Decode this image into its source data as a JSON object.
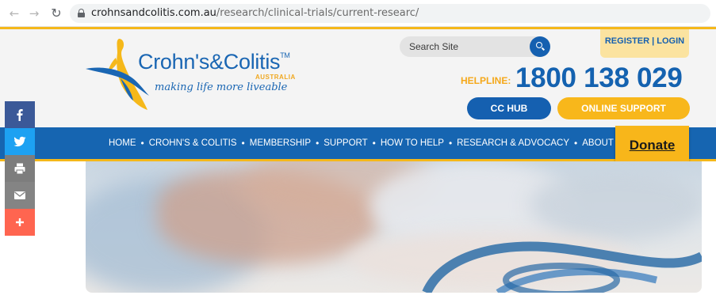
{
  "browser": {
    "url_domain": "crohnsandcolitis.com.au",
    "url_path": "/research/clinical-trials/current-researc/"
  },
  "logo": {
    "name": "Crohn's&Colitis",
    "trademark": "TM",
    "subtitle": "AUSTRALIA",
    "tagline": "making life more liveable"
  },
  "search": {
    "placeholder": "Search Site"
  },
  "header": {
    "register_label": "REGISTER | LOGIN",
    "helpline_label": "HELPLINE:",
    "helpline_number": "1800 138 029",
    "cc_hub_label": "CC HUB",
    "online_support_label": "ONLINE SUPPORT"
  },
  "nav": {
    "items": [
      "HOME",
      "CROHN'S & COLITIS",
      "MEMBERSHIP",
      "SUPPORT",
      "HOW TO HELP",
      "RESEARCH & ADVOCACY",
      "ABOUT"
    ],
    "separator": "•"
  },
  "donate": {
    "label": "Donate"
  },
  "social": [
    {
      "icon": "facebook-icon",
      "color": "#3b5998"
    },
    {
      "icon": "twitter-icon",
      "color": "#1da1f2"
    },
    {
      "icon": "print-icon",
      "color": "#7d7d7d"
    },
    {
      "icon": "email-icon",
      "color": "#848484"
    },
    {
      "icon": "plus-icon",
      "color": "#ff6550"
    }
  ],
  "colors": {
    "brand_blue": "#1665b1",
    "brand_yellow": "#f5b81a"
  }
}
